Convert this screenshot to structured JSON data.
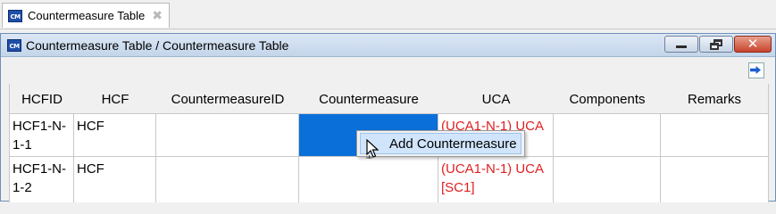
{
  "tab": {
    "icon": "app-icon",
    "label": "Countermeasure Table",
    "close_glyph": "✖"
  },
  "window": {
    "title": "Countermeasure Table / Countermeasure Table",
    "buttons": [
      "minimize-icon",
      "restore-icon",
      "close-icon"
    ]
  },
  "toolbar": {
    "icon": "forward-arrow-icon"
  },
  "table": {
    "columns": [
      "HCFID",
      "HCF",
      "CountermeasureID",
      "Countermeasure",
      "UCA",
      "Components",
      "Remarks"
    ],
    "rows": [
      {
        "hcfid": "HCF1-N-1-1",
        "hcf": "HCF",
        "countermeasure_id": "",
        "countermeasure": "",
        "uca": "(UCA1-N-1) UCA",
        "components": "",
        "remarks": "",
        "selected_column": "Countermeasure"
      },
      {
        "hcfid": "HCF1-N-1-2",
        "hcf": "HCF",
        "countermeasure_id": "",
        "countermeasure": "",
        "uca": "(UCA1-N-1) UCA [SC1]",
        "components": "",
        "remarks": ""
      }
    ]
  },
  "context_menu": {
    "items": [
      "Add Countermeasure"
    ]
  },
  "colors": {
    "selection": "#0a6fd9",
    "uca_text": "#e02020",
    "menu_highlight": "#d0e4fb"
  }
}
